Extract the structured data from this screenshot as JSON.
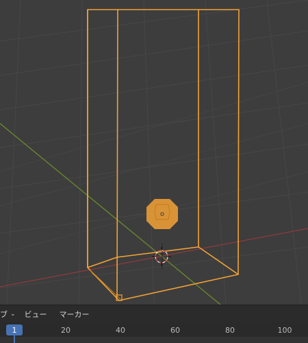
{
  "timeline": {
    "mode_dropdown_label": "ブ",
    "menu_view": "ビュー",
    "menu_marker": "マーカー",
    "current_frame": "1",
    "ticks": [
      "20",
      "40",
      "60",
      "80",
      "100"
    ]
  },
  "colors": {
    "viewport_bg": "#3d3d3d",
    "grid": "#4a4a4a",
    "selection_orange": "#f4a236",
    "x_axis_red": "#8a3b3f",
    "y_axis_green": "#6b8a2e",
    "frame_accent": "#4772b3"
  },
  "icons": {
    "light_object": "light-icon",
    "cursor_3d": "3d-cursor-icon",
    "origin": "object-origin-icon"
  }
}
